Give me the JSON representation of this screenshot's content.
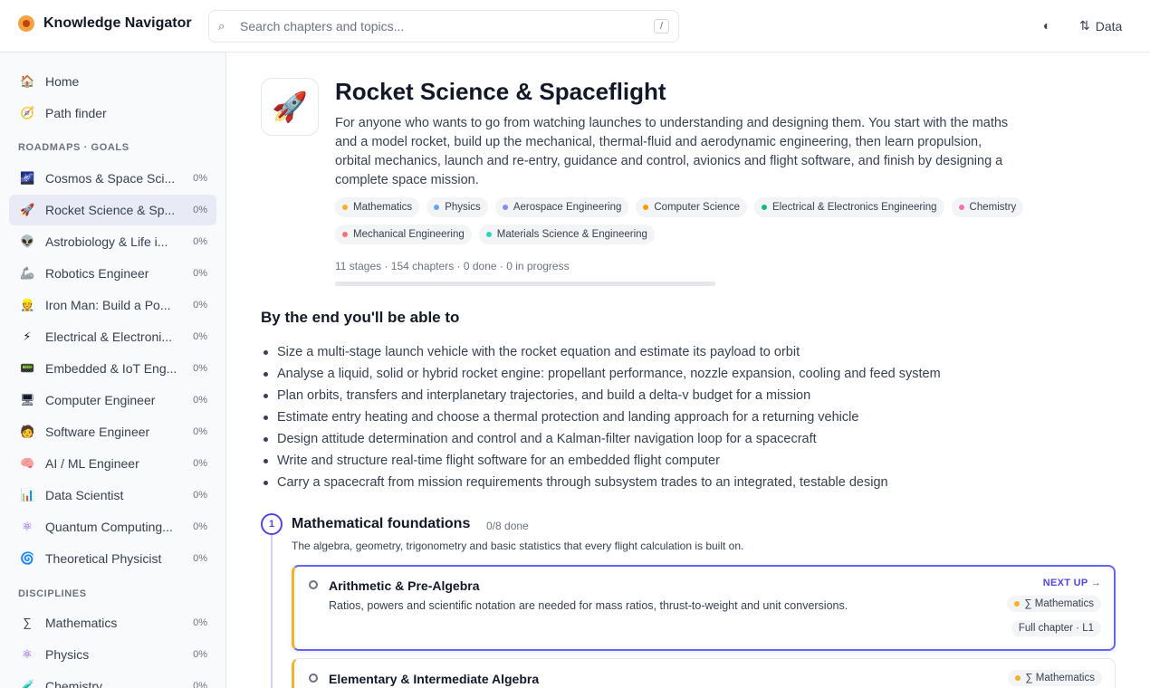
{
  "app": {
    "name": "Knowledge Navigator"
  },
  "search": {
    "placeholder": "Search chapters and topics...",
    "shortcut": "/"
  },
  "header": {
    "theme_icon": "contrast-icon",
    "data_label": "Data",
    "data_icon": "⇅"
  },
  "sidebar": {
    "top_items": [
      {
        "label": "Home",
        "icon": "home-icon",
        "glyph": "🏠"
      },
      {
        "label": "Path finder",
        "icon": "compass-icon",
        "glyph": "🧭"
      }
    ],
    "roadmaps_heading": "ROADMAPS · GOALS",
    "roadmaps": [
      {
        "label": "Cosmos & Space Sci...",
        "pct": "0%",
        "glyph": "🌌"
      },
      {
        "label": "Rocket Science & Sp...",
        "pct": "0%",
        "glyph": "🚀",
        "active": true
      },
      {
        "label": "Astrobiology & Life i...",
        "pct": "0%",
        "glyph": "👽"
      },
      {
        "label": "Robotics Engineer",
        "pct": "0%",
        "glyph": "🦾"
      },
      {
        "label": "Iron Man: Build a Po...",
        "pct": "0%",
        "glyph": "👷"
      },
      {
        "label": "Electrical & Electroni...",
        "pct": "0%",
        "glyph": "⚡"
      },
      {
        "label": "Embedded & IoT Eng...",
        "pct": "0%",
        "glyph": "📟"
      },
      {
        "label": "Computer Engineer",
        "pct": "0%",
        "glyph": "🖥"
      },
      {
        "label": "Software Engineer",
        "pct": "0%",
        "glyph": "🧑"
      },
      {
        "label": "AI / ML Engineer",
        "pct": "0%",
        "glyph": "🧠"
      },
      {
        "label": "Data Scientist",
        "pct": "0%",
        "glyph": "📊"
      },
      {
        "label": "Quantum Computing...",
        "pct": "0%",
        "glyph": "⚛"
      },
      {
        "label": "Theoretical Physicist",
        "pct": "0%",
        "glyph": "🌀"
      }
    ],
    "disciplines_heading": "DISCIPLINES",
    "disciplines": [
      {
        "label": "Mathematics",
        "pct": "0%",
        "glyph": "∑"
      },
      {
        "label": "Physics",
        "pct": "0%",
        "glyph": "⚛"
      },
      {
        "label": "Chemistry",
        "pct": "0%",
        "glyph": "🧪"
      }
    ]
  },
  "main": {
    "hero_glyph": "🚀",
    "title": "Rocket Science & Spaceflight",
    "description": "For anyone who wants to go from watching launches to understanding and designing them. You start with the maths and a model rocket, build up the mechanical, thermal-fluid and aerodynamic engineering, then learn propulsion, orbital mechanics, launch and re-entry, guidance and control, avionics and flight software, and finish by designing a complete space mission.",
    "tags": [
      {
        "label": "Mathematics",
        "color": "#f5b12b"
      },
      {
        "label": "Physics",
        "color": "#60a5fa"
      },
      {
        "label": "Aerospace Engineering",
        "color": "#818cf8"
      },
      {
        "label": "Computer Science",
        "color": "#f59e0b"
      },
      {
        "label": "Electrical & Electronics Engineering",
        "color": "#10b981"
      },
      {
        "label": "Chemistry",
        "color": "#f472b6"
      },
      {
        "label": "Mechanical Engineering",
        "color": "#f87171"
      },
      {
        "label": "Materials Science & Engineering",
        "color": "#2dd4bf"
      }
    ],
    "stats": "11 stages · 154 chapters · 0 done · 0 in progress",
    "progress": 0,
    "goals_title": "By the end you'll be able to",
    "goals": [
      "Size a multi-stage launch vehicle with the rocket equation and estimate its payload to orbit",
      "Analyse a liquid, solid or hybrid rocket engine: propellant performance, nozzle expansion, cooling and feed system",
      "Plan orbits, transfers and interplanetary trajectories, and build a delta-v budget for a mission",
      "Estimate entry heating and choose a thermal protection and landing approach for a returning vehicle",
      "Design attitude determination and control and a Kalman-filter navigation loop for a spacecraft",
      "Write and structure real-time flight software for an embedded flight computer",
      "Carry a spacecraft from mission requirements through subsystem trades to an integrated, testable design"
    ],
    "stage": {
      "number": "1",
      "title": "Mathematical foundations",
      "count": "0/8 done",
      "description": "The algebra, geometry, trigonometry and basic statistics that every flight calculation is built on.",
      "chapters": [
        {
          "title": "Arithmetic & Pre-Algebra",
          "description": "Ratios, powers and scientific notation are needed for mass ratios, thrust-to-weight and unit conversions.",
          "next_up": "NEXT UP →",
          "subject": "∑ Mathematics",
          "subject_color": "#f5b12b",
          "level": "Full chapter · L1"
        },
        {
          "title": "Elementary & Intermediate Algebra",
          "subject": "∑ Mathematics",
          "subject_color": "#f5b12b"
        }
      ]
    }
  }
}
